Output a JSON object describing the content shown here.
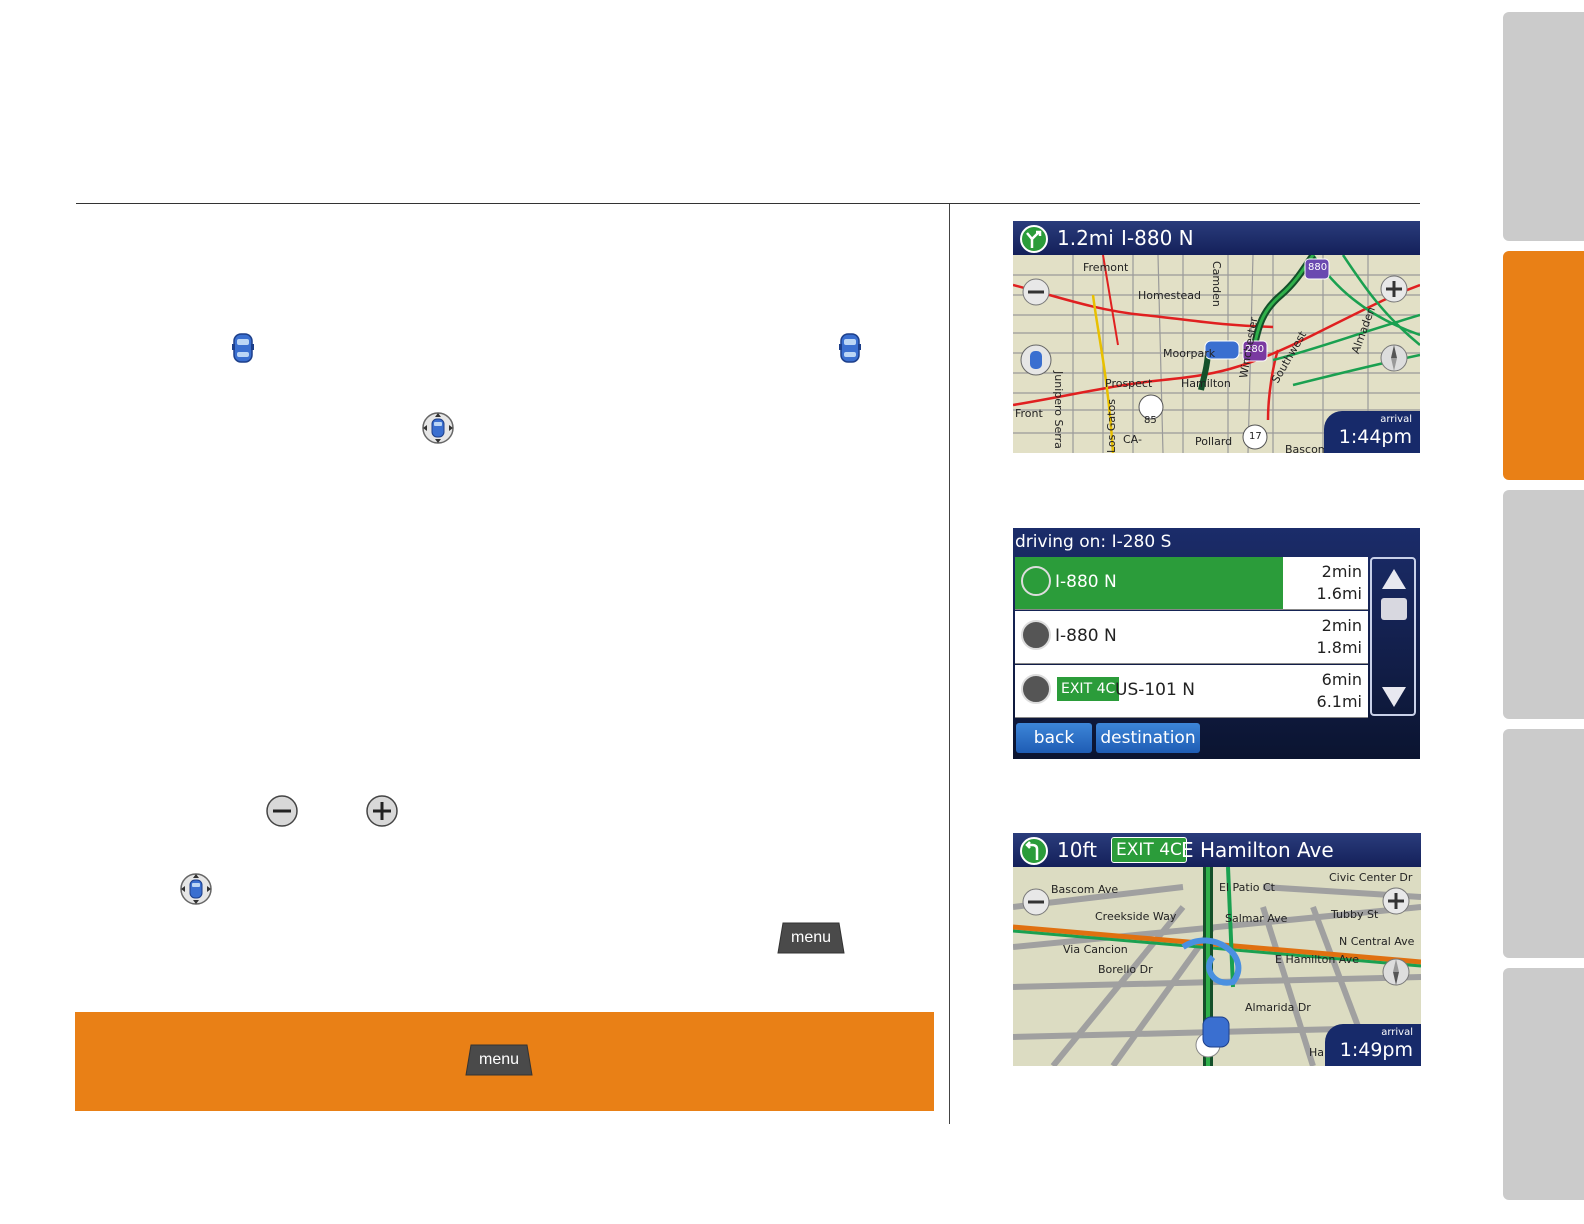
{
  "sidetabs": [
    {
      "name": "tab-1",
      "active": false
    },
    {
      "name": "tab-2",
      "active": true
    },
    {
      "name": "tab-3",
      "active": false
    },
    {
      "name": "tab-4",
      "active": false
    },
    {
      "name": "tab-5",
      "active": false
    }
  ],
  "icons": {
    "car": "car-icon",
    "recenter": "recenter-icon",
    "zoom_out": "zoom-out-icon",
    "zoom_in": "zoom-in-icon"
  },
  "menu_key_label": "menu",
  "note_menu_key_label": "menu",
  "colors": {
    "accent": "#e98016",
    "tab_gray": "#cbcbcb",
    "nav_bar": "#14205a",
    "route_green": "#2b9c3a"
  },
  "screen1": {
    "distance": "1.2mi",
    "road": "I-880 N",
    "arrival_label": "arrival",
    "arrival_time": "1:44pm",
    "labels": [
      "Fremont",
      "Homestead",
      "Camden",
      "Moorpark",
      "Prospect",
      "Hamilton",
      "Front",
      "Los Gatos",
      "Pollard",
      "Winchester",
      "Junipero Serra",
      "Southwest",
      "Almaden",
      "Bascom",
      "880",
      "280",
      "85",
      "17",
      "CA-"
    ]
  },
  "screen2": {
    "header": "driving on: I-280 S",
    "rows": [
      {
        "name": "I-880 N",
        "time": "2min",
        "dist": "1.6mi",
        "exit": "",
        "selected": true
      },
      {
        "name": "I-880 N",
        "time": "2min",
        "dist": "1.8mi",
        "exit": "",
        "selected": false
      },
      {
        "name": "US-101 N",
        "time": "6min",
        "dist": "6.1mi",
        "exit": "EXIT 4C",
        "selected": false
      }
    ],
    "back_label": "back",
    "destination_label": "destination"
  },
  "screen3": {
    "distance": "10ft",
    "exit": "EXIT 4C",
    "road": "E Hamilton Ave",
    "arrival_label": "arrival",
    "arrival_time": "1:49pm",
    "labels": [
      "Bascom Ave",
      "El Patio Ct",
      "Civic Center Dr",
      "Creekside Way",
      "Salmar Ave",
      "Tubby St",
      "N Central Ave",
      "Via Cancion",
      "E Hamilton Ave",
      "Borello Dr",
      "Almarida Dr",
      "Har"
    ]
  }
}
